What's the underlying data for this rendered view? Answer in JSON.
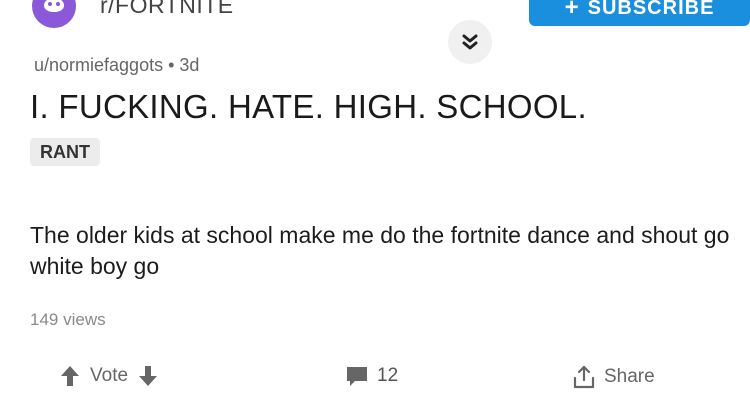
{
  "header": {
    "subreddit": "r/FORTNITE",
    "subscribe_label": "SUBSCRIBE",
    "subscribe_icon": "plus-icon",
    "collapse_icon": "chevrons-down-icon"
  },
  "post": {
    "meta": "u/normiefaggots • 3d",
    "title": "I. FUCKING. HATE. HIGH. SCHOOL.",
    "flair": "RANT",
    "body": "The older kids at school make me do the fortnite dance and shout go white boy go",
    "views": "149 views"
  },
  "actions": {
    "vote_label": "Vote",
    "comment_count": "12",
    "share_label": "Share"
  },
  "colors": {
    "accent": "#1a8fde",
    "avatar": "#8a58d9",
    "text": "#1a1a1a",
    "muted": "#8a8a8a"
  }
}
